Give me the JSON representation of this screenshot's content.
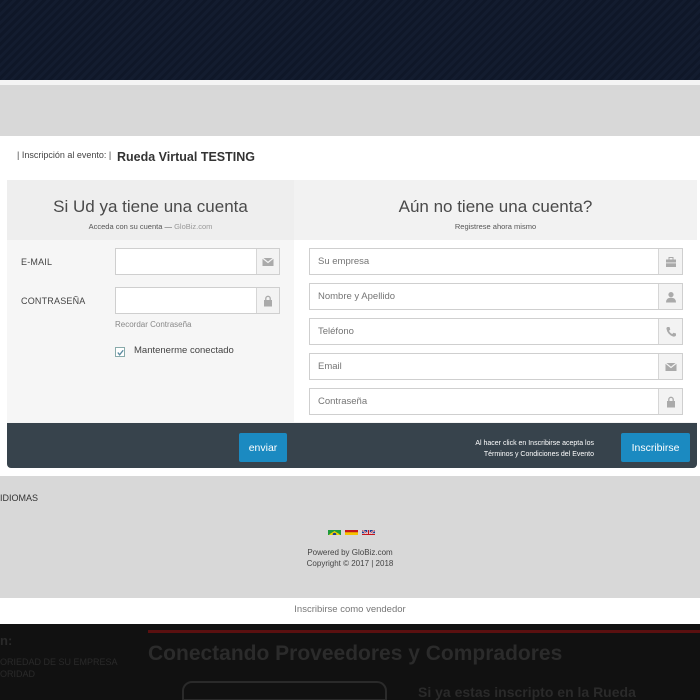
{
  "event": {
    "prefix": "| Inscripción al evento: |",
    "name": "Rueda Virtual TESTING"
  },
  "login": {
    "heading": "Si Ud ya tiene una cuenta",
    "subheading": "Acceda con su cuenta — ",
    "brand": "GloBiz.com",
    "email_label": "E-MAIL",
    "password_label": "CONTRASEÑA",
    "remember_password": "Recordar Contraseña",
    "keep_logged": "Mantenerme conectado",
    "submit": "enviar"
  },
  "register": {
    "heading": "Aún no tiene una cuenta?",
    "subheading": "Registrese ahora mismo",
    "company_placeholder": "Su empresa",
    "name_placeholder": "Nombre y Apellido",
    "phone_placeholder": "Teléfono",
    "email_placeholder": "Email",
    "password_placeholder": "Contraseña",
    "terms_line1": "Al hacer click en Inscribirse acepta los",
    "terms_line2": "Términos y Condiciones del Evento",
    "submit": "Inscribirse"
  },
  "footer": {
    "languages_label": "IDIOMAS",
    "flags": [
      "brazil-flag-icon",
      "spain-flag-icon",
      "uk-flag-icon"
    ],
    "powered": "Powered by GloBiz.com",
    "copyright": "Copyright © 2017 | 2018",
    "seller_link": "Inscribirse como vendedor"
  },
  "background_page": {
    "left_heading": "n:",
    "title": "Conectando Proveedores y Compradores",
    "left_line1": "ORIEDAD DE SU EMPRESA",
    "left_line2": "ORIDAD",
    "right_text": "Si ya estas inscripto en la Rueda"
  },
  "colors": {
    "accent": "#1b8ac1",
    "footer_bar": "#37434c",
    "dark_bg": "#0f1626"
  }
}
